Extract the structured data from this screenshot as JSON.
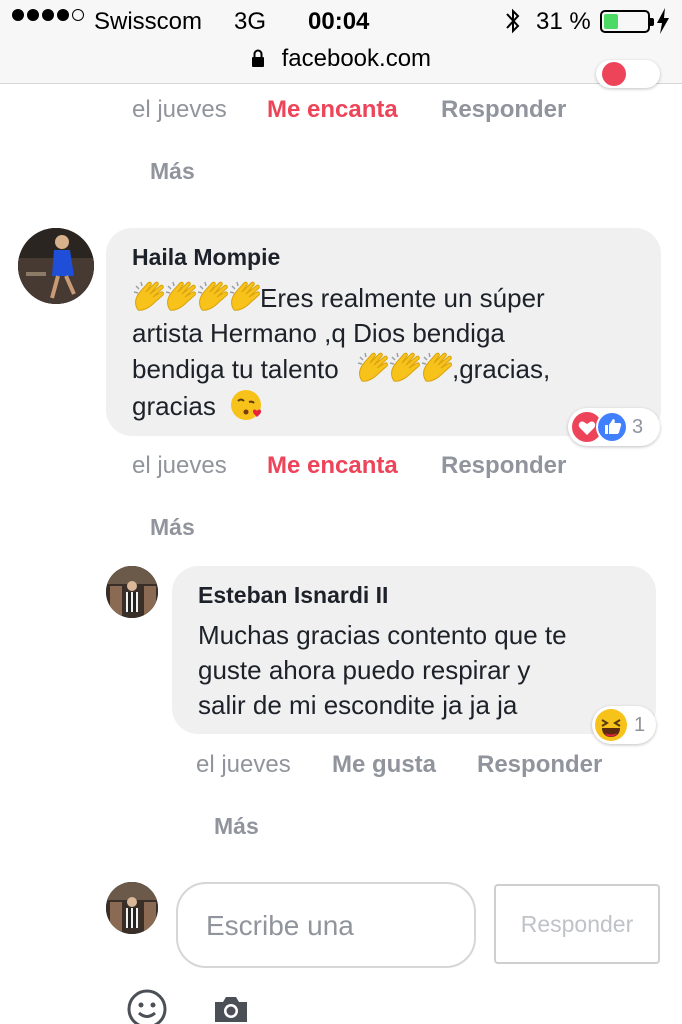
{
  "status_bar": {
    "carrier": "Swisscom",
    "network": "3G",
    "time": "00:04",
    "battery_percent": "31 %",
    "battery_level": 0.31,
    "battery_color": "#4cd964"
  },
  "browser": {
    "url": "facebook.com"
  },
  "top_actions": {
    "time": "el jueves",
    "reaction": "Me encanta",
    "reply": "Responder",
    "more": "Más"
  },
  "comments": [
    {
      "author": "Haila Mompie",
      "line1_text": "Eres realmente un súper",
      "line2_text": "artista Hermano ,q Dios bendiga",
      "line3_text": "bendiga tu talento",
      "line3_suffix": ",gracias,",
      "line4_text": "gracias",
      "emoji_icons": [
        "clapping-hands-icon",
        "kiss-face-icon"
      ],
      "reactions": {
        "icons": [
          "heart-icon",
          "like-icon"
        ],
        "count": "3"
      },
      "actions": {
        "time": "el jueves",
        "reaction": "Me encanta",
        "reply": "Responder",
        "more": "Más"
      }
    },
    {
      "author": "Esteban Isnardi II",
      "line1_text": "Muchas gracias contento que te",
      "line2_text": "guste ahora puedo respirar y",
      "line3_text": "salir de mi escondite ja ja ja",
      "reactions": {
        "icons": [
          "haha-icon"
        ],
        "count": "1"
      },
      "actions": {
        "time": "el jueves",
        "reaction": "Me gusta",
        "reply": "Responder",
        "more": "Más"
      }
    }
  ],
  "reply_box": {
    "placeholder": "Escribe una",
    "button": "Responder"
  },
  "bottom_icons": [
    "smiley-icon",
    "camera-icon"
  ],
  "colors": {
    "love": "#ed4459",
    "like": "#4080ff",
    "muted": "#90949c",
    "bubble": "#f1f0f0"
  }
}
